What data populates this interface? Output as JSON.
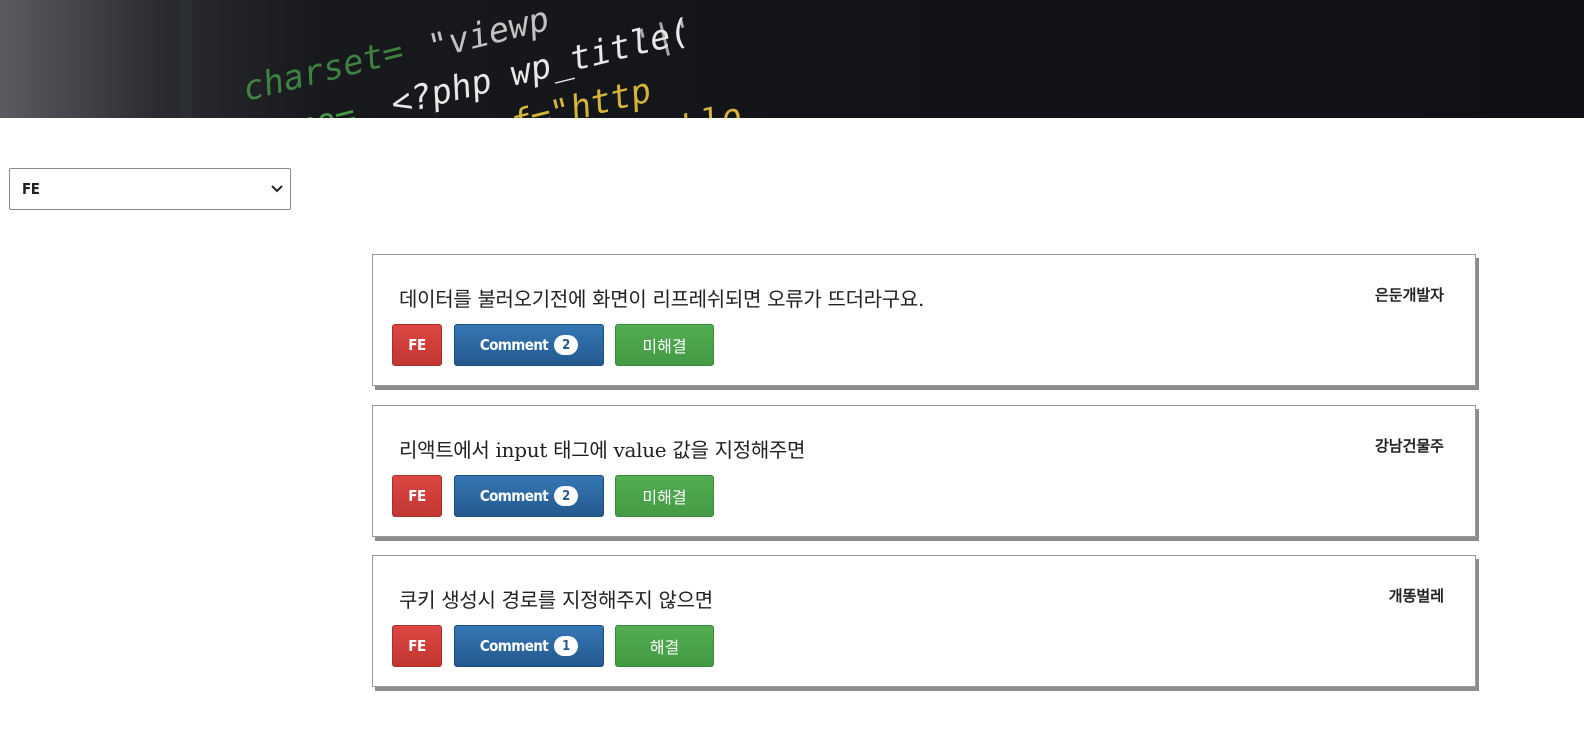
{
  "filter": {
    "selected": "FE"
  },
  "posts": [
    {
      "title": "데이터를 불러오기전에 화면이 리프레쉬되면 오류가 뜨더라구요.",
      "author": "은둔개발자",
      "tag": "FE",
      "comment_label": "Comment",
      "comment_count": "2",
      "status": "미해결"
    },
    {
      "title": "리액트에서 input 태그에 value 값을 지정해주면",
      "author": "강남건물주",
      "tag": "FE",
      "comment_label": "Comment",
      "comment_count": "2",
      "status": "미해결"
    },
    {
      "title": "쿠키 생성시 경로를 지정해주지 않으면",
      "author": "개똥벌레",
      "tag": "FE",
      "comment_label": "Comment",
      "comment_count": "1",
      "status": "해결"
    }
  ],
  "colors": {
    "tag": "#c9413c",
    "comment": "#2c67a3",
    "status": "#49a349"
  }
}
